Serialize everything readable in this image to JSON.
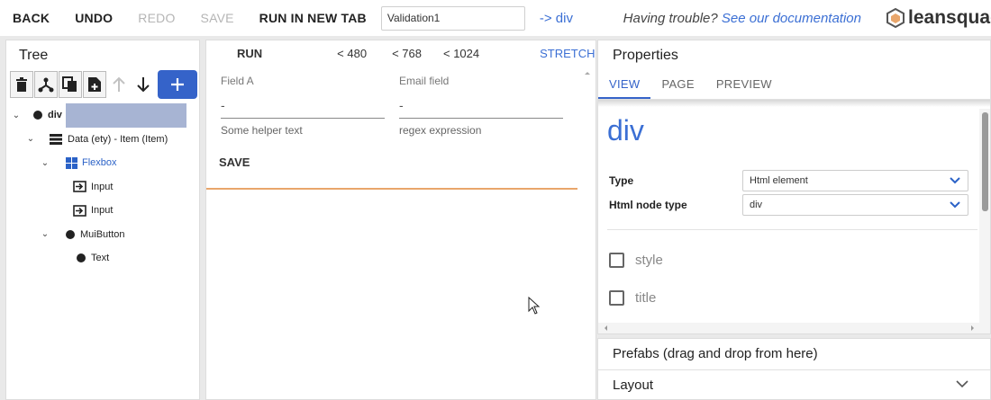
{
  "toolbar": {
    "back": "BACK",
    "undo": "UNDO",
    "redo": "REDO",
    "save": "SAVE",
    "run_new_tab": "RUN IN NEW TAB",
    "component_name": "Validation1",
    "breadcrumb": "-> div",
    "help_text": "Having trouble? ",
    "help_link": "See our documentation",
    "logo_text": "leansquad"
  },
  "tree_panel": {
    "title": "Tree",
    "nodes": [
      {
        "label": "div",
        "icon": "dot-icon",
        "expanded": true,
        "selected": true
      },
      {
        "label": "Data (ety) - Item (Item)",
        "icon": "data-icon",
        "expanded": true
      },
      {
        "label": "Flexbox",
        "icon": "flexbox-icon",
        "expanded": true
      },
      {
        "label": "Input",
        "icon": "input-icon"
      },
      {
        "label": "Input",
        "icon": "input-icon"
      },
      {
        "label": "MuiButton",
        "icon": "dot-icon",
        "expanded": true
      },
      {
        "label": "Text",
        "icon": "dot-icon"
      }
    ]
  },
  "canvas": {
    "run": "RUN",
    "breakpoints": [
      "< 480",
      "< 768",
      "< 1024"
    ],
    "stretch": "STRETCH",
    "fields": [
      {
        "label": "Field A",
        "value": "-",
        "helper": "Some helper text"
      },
      {
        "label": "Email field",
        "value": "-",
        "helper": "regex expression"
      }
    ],
    "save_button": "SAVE"
  },
  "properties": {
    "title": "Properties",
    "tabs": [
      "VIEW",
      "PAGE",
      "PREVIEW"
    ],
    "active_tab": "VIEW",
    "heading": "div",
    "type_label": "Type",
    "type_value": "Html element",
    "node_type_label": "Html node type",
    "node_type_value": "div",
    "checkboxes": [
      "style",
      "title"
    ]
  },
  "prefabs": {
    "title": "Prefabs (drag and drop from here)",
    "layout": "Layout"
  },
  "colors": {
    "accent": "#3563c9",
    "link": "#3b6fd4",
    "selected_bg": "#a7b4d3",
    "drop_line": "#e9a66b"
  }
}
